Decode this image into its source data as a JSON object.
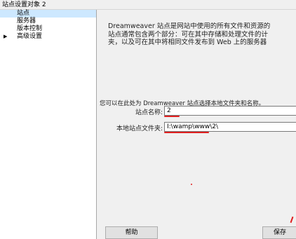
{
  "window": {
    "title": "站点设置对象 2"
  },
  "sidebar": {
    "items": [
      {
        "label": "站点",
        "selected": true,
        "expandable": false
      },
      {
        "label": "服务器",
        "selected": false,
        "expandable": false
      },
      {
        "label": "版本控制",
        "selected": false,
        "expandable": false
      },
      {
        "label": "高级设置",
        "selected": false,
        "expandable": true
      }
    ]
  },
  "main": {
    "description": "Dreamweaver 站点是网站中使用的所有文件和资源的\n站点通常包含两个部分：可在其中存储和处理文件的计\n夹，以及可在其中将相同文件发布到 Web 上的服务器",
    "prompt": "您可以在此处为 Dreamweaver 站点选择本地文件夹和名称。",
    "site_name_label": "站点名称:",
    "site_name_value": "2",
    "local_folder_label": "本地站点文件夹:",
    "local_folder_value": "I:\\wamp\\www\\2\\"
  },
  "footer": {
    "help_label": "帮助",
    "save_label": "保存"
  },
  "colors": {
    "selection": "#cde8ff",
    "annotation": "#e02020",
    "panel": "#f0f0f0"
  }
}
